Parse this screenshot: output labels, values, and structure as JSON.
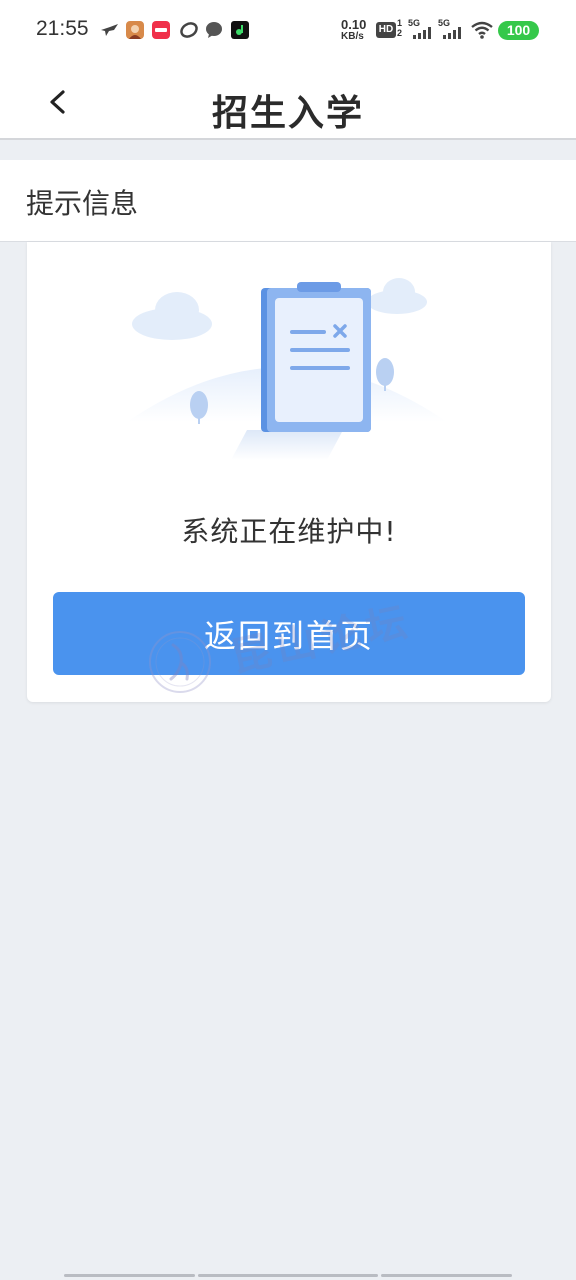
{
  "status_bar": {
    "time": "21:55",
    "net_speed_value": "0.10",
    "net_speed_unit": "KB/s",
    "hd_label": "HD",
    "sim1_label": "5G",
    "sim2_label": "5G",
    "battery": "100",
    "notification_icons": [
      "bird-icon",
      "game-avatar-icon",
      "app-badge-icon",
      "link-icon",
      "chat-bubble-icon",
      "music-app-icon"
    ]
  },
  "header": {
    "title": "招生入学",
    "back_icon": "chevron-left-icon"
  },
  "section": {
    "title": "提示信息"
  },
  "card": {
    "illustration": "clipboard-maintenance-illustration",
    "message": "系统正在维护中!",
    "button_label": "返回到首页"
  },
  "watermark": {
    "text": "昆山论坛"
  },
  "colors": {
    "accent": "#4a93ee",
    "background": "#eceff3",
    "battery": "#35c84a"
  }
}
